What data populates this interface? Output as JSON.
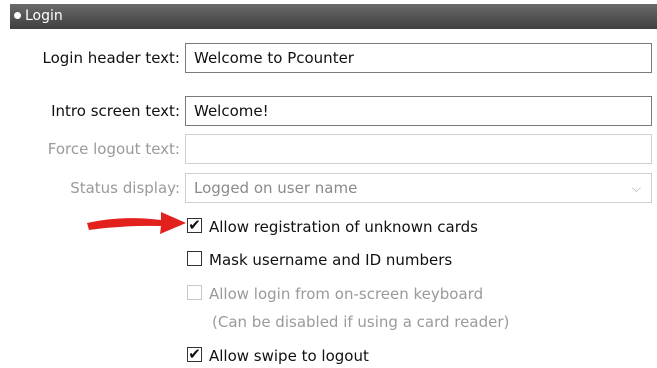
{
  "section": {
    "title": "Login"
  },
  "fields": {
    "login_header": {
      "label": "Login header text:",
      "value": "Welcome to Pcounter"
    },
    "intro_screen": {
      "label": "Intro screen text:",
      "value": "Welcome!"
    },
    "force_logout": {
      "label": "Force logout text:",
      "value": ""
    },
    "status_display": {
      "label": "Status display:",
      "value": "Logged on user name",
      "chevron": "⌵"
    }
  },
  "checkboxes": {
    "allow_registration": {
      "label": "Allow registration of unknown cards",
      "checked": true,
      "mark": "✔"
    },
    "mask_username": {
      "label": "Mask username and ID numbers",
      "checked": false
    },
    "onscreen_keyboard": {
      "label": "Allow login from on-screen keyboard",
      "checked": false,
      "note": "(Can be disabled if using a card reader)"
    },
    "swipe_logout": {
      "label": "Allow swipe to logout",
      "checked": true,
      "mark": "✔"
    }
  },
  "colors": {
    "annotation_arrow": "#e3211c",
    "header_bg": "#4a4a4a"
  }
}
